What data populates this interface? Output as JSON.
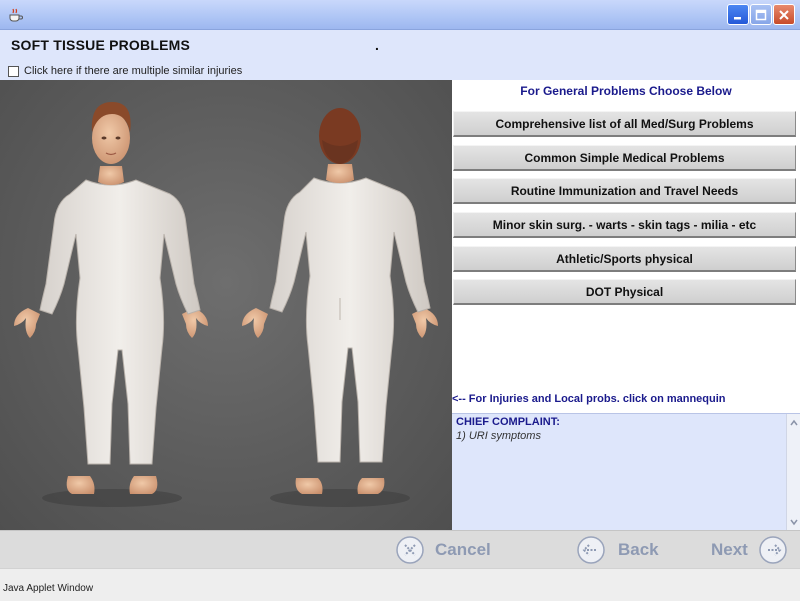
{
  "window": {
    "controls": {
      "minimize_icon": "minimize-icon",
      "maximize_icon": "maximize-icon",
      "close_icon": "close-icon"
    },
    "app_icon": "java-coffee-icon"
  },
  "header": {
    "title": "SOFT TISSUE PROBLEMS",
    "dot": ".",
    "multiple_injuries_label": "Click here if there are multiple similar injuries",
    "multiple_injuries_checked": false
  },
  "mannequin": {
    "views": [
      "front",
      "back"
    ]
  },
  "general": {
    "heading": "For General Problems Choose Below",
    "buttons": [
      "Comprehensive list of all Med/Surg Problems",
      "Common Simple Medical Problems",
      "Routine Immunization and Travel Needs",
      "Minor skin surg. - warts - skin tags - milia - etc",
      "Athletic/Sports physical",
      "DOT Physical"
    ],
    "hint": "<-- For Injuries and Local probs. click on mannequin"
  },
  "chief_complaint": {
    "title": "CHIEF COMPLAINT:",
    "items": [
      "1) URI symptoms"
    ]
  },
  "nav": {
    "cancel_label": "Cancel",
    "back_label": "Back",
    "next_label": "Next"
  },
  "status": {
    "text": "Java Applet Window"
  },
  "colors": {
    "accent_text": "#1a1a8c",
    "header_bg": "#dee6fb",
    "nav_label": "#8e9ab3"
  }
}
